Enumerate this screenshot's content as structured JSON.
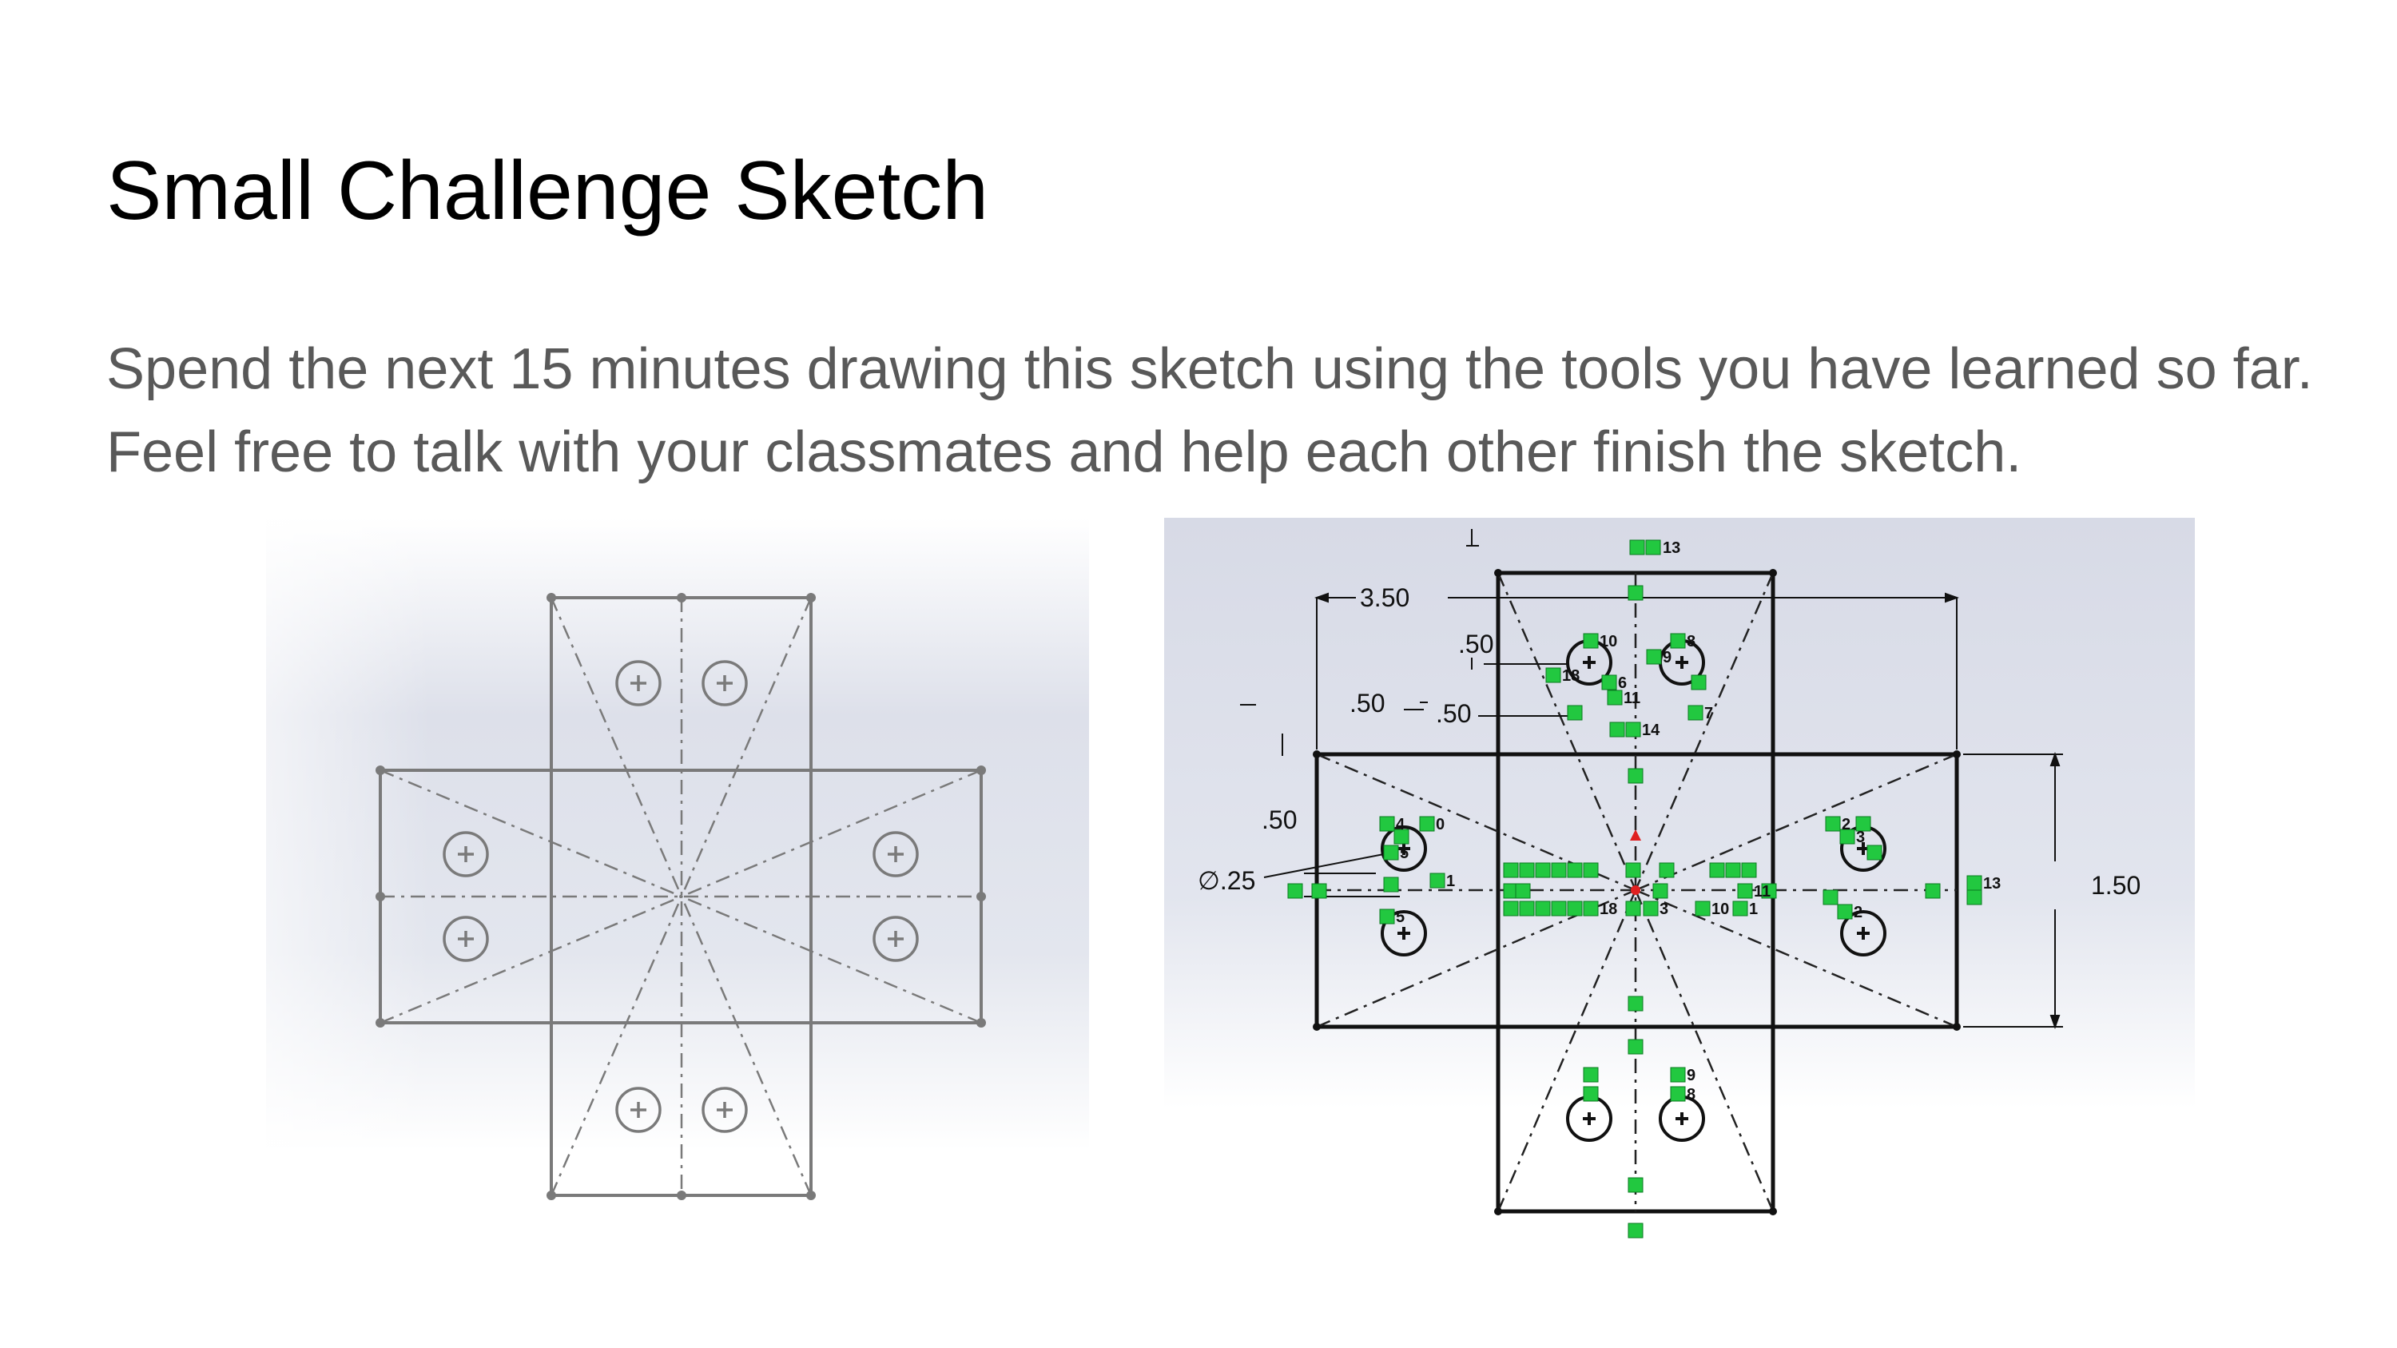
{
  "slide": {
    "title": "Small Challenge Sketch",
    "body": "Spend the next 15 minutes drawing this sketch using the tools you have learned so far. Feel free to talk with your classmates and help each other finish the sketch."
  },
  "left_figure": {
    "kind": "reference sketch (undimensioned)",
    "hole_count": 8
  },
  "right_figure": {
    "kind": "dimensioned sketch with relations",
    "dimensions": {
      "overall_width": "3.50",
      "arm_width": "1.50",
      "arm_length": ".50",
      "hole_offset": ".50",
      "hole_edge": ".50",
      "hole_spacing": ".50",
      "hole_diameter": "∅.25"
    },
    "relation_labels": [
      "13",
      "10",
      "8",
      "9",
      "18",
      "6",
      "11",
      "7",
      "14",
      "4",
      "0",
      "5",
      "1",
      "2",
      "3",
      "13",
      "11",
      "10",
      "9",
      "8",
      "5",
      "3",
      "2",
      "1",
      "18"
    ]
  },
  "colors": {
    "title": "#000000",
    "body_text": "#595959",
    "sketch_gray": "#7a7a7a",
    "sketch_black": "#111111",
    "relation_green": "#22c840",
    "panel_bg_top": "#d9dce8",
    "panel_bg_bottom": "#ffffff"
  }
}
